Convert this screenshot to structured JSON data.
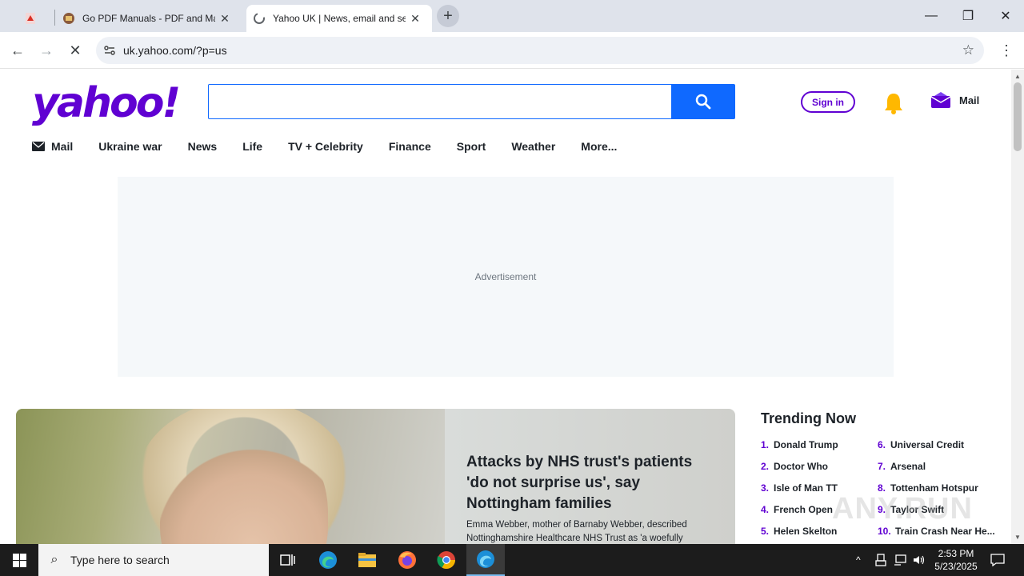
{
  "browser": {
    "tabs": [
      {
        "title": "",
        "icon": "pdf-icon"
      },
      {
        "title": "Go PDF Manuals - PDF and Ma",
        "icon": "gopdf-icon"
      },
      {
        "title": "Yahoo UK | News, email and sea",
        "icon": "yahoo-loading-icon",
        "active": true
      }
    ],
    "url": "uk.yahoo.com/?p=us"
  },
  "header": {
    "logo": "yahoo!",
    "search_placeholder": "",
    "signin_label": "Sign in",
    "mail_label": "Mail"
  },
  "nav": {
    "items": [
      "Mail",
      "Ukraine war",
      "News",
      "Life",
      "TV + Celebrity",
      "Finance",
      "Sport",
      "Weather",
      "More..."
    ]
  },
  "ad": {
    "label": "Advertisement"
  },
  "hero": {
    "headline": "Attacks by NHS trust's patients 'do not surprise us', say Nottingham families",
    "summary": "Emma Webber, mother of Barnaby Webber, described Nottinghamshire Healthcare NHS Trust as 'a woefully"
  },
  "trending": {
    "title": "Trending Now",
    "left": [
      {
        "num": "1.",
        "name": "Donald Trump"
      },
      {
        "num": "2.",
        "name": "Doctor Who"
      },
      {
        "num": "3.",
        "name": "Isle of Man TT"
      },
      {
        "num": "4.",
        "name": "French Open"
      },
      {
        "num": "5.",
        "name": "Helen Skelton"
      }
    ],
    "right": [
      {
        "num": "6.",
        "name": "Universal Credit"
      },
      {
        "num": "7.",
        "name": "Arsenal"
      },
      {
        "num": "8.",
        "name": "Tottenham Hotspur"
      },
      {
        "num": "9.",
        "name": "Taylor Swift"
      },
      {
        "num": "10.",
        "name": "Train Crash Near He..."
      }
    ]
  },
  "watermark": "ANY.RUN",
  "taskbar": {
    "search_placeholder": "Type here to search",
    "time": "2:53 PM",
    "date": "5/23/2025"
  },
  "colors": {
    "brand": "#6001d2",
    "search_button": "#0f69ff"
  }
}
